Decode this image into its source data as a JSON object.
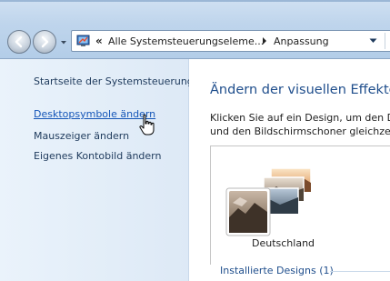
{
  "toolbar": {
    "back_icon": "back-arrow-icon",
    "forward_icon": "forward-arrow-icon",
    "address": {
      "icon": "control-panel-icon",
      "overflow_chevron": "«",
      "segments": [
        "Alle Systemsteuerungselemente",
        "Anpassung"
      ],
      "segment_1_display": "Alle Systemsteuerungseleme...",
      "segment_2_display": "Anpassung"
    }
  },
  "sidebar": {
    "items": [
      {
        "label": "Startseite der Systemsteuerung"
      },
      {
        "label": "Desktopsymbole ändern"
      },
      {
        "label": "Mauszeiger ändern"
      },
      {
        "label": "Eigenes Kontobild ändern"
      }
    ]
  },
  "main": {
    "title": "Ändern der visuellen Effekte",
    "description_line1": "Klicken Sie auf ein Design, um den De",
    "description_line2": "und den Bildschirmschoner gleichzeit",
    "theme": {
      "name": "Deutschland"
    },
    "installed_label": "Installierte Designs (1)"
  },
  "colors": {
    "link": "#1556b8",
    "title": "#1f4e8c",
    "sidebar_bg": "#dde9f6"
  }
}
